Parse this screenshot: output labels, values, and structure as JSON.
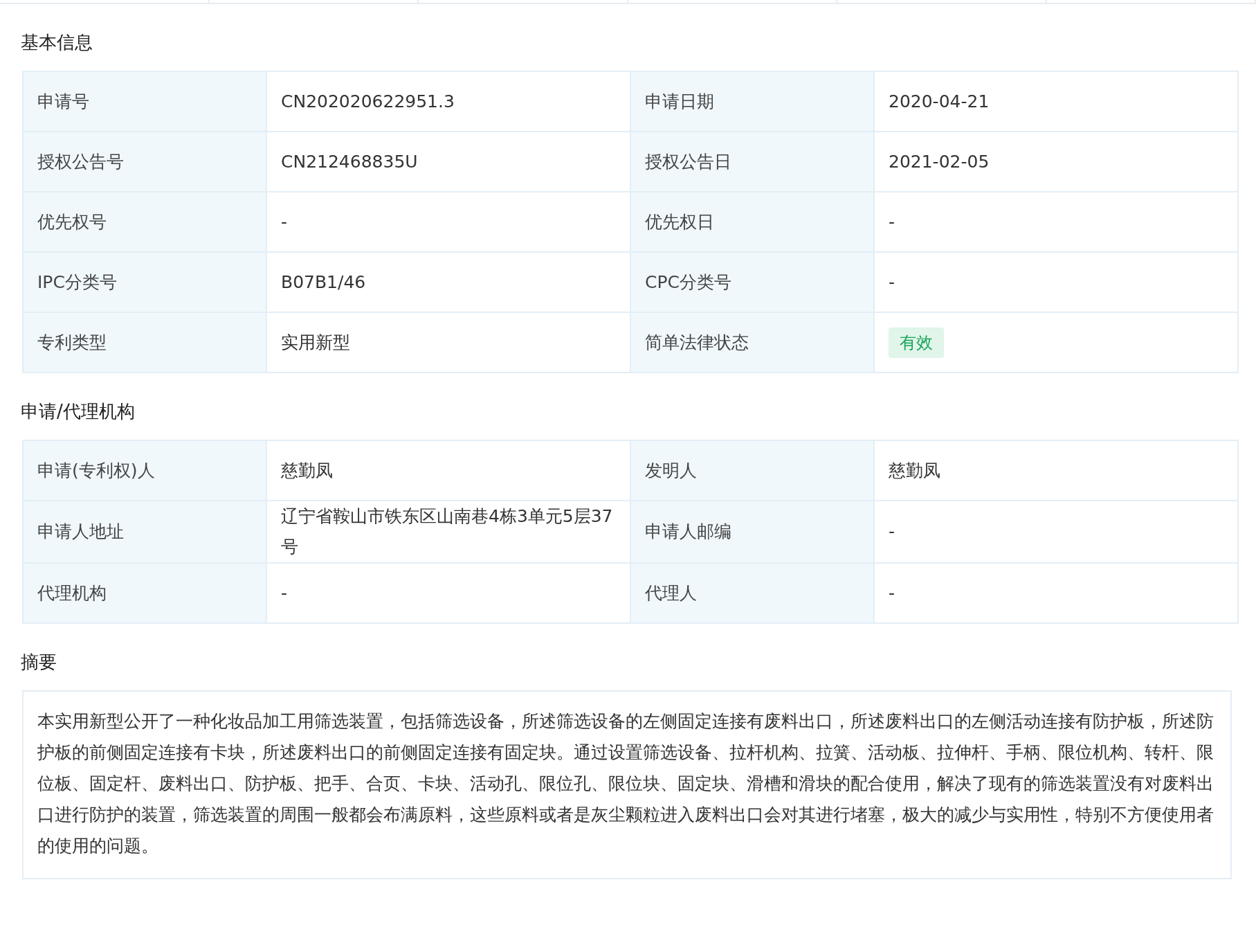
{
  "sections": [
    {
      "title": "基本信息",
      "kind": "table",
      "rows": [
        [
          {
            "label": "申请号",
            "value": "CN202020622951.3",
            "kind": "text"
          },
          {
            "label": "申请日期",
            "value": "2020-04-21",
            "kind": "text"
          }
        ],
        [
          {
            "label": "授权公告号",
            "value": "CN212468835U",
            "kind": "text"
          },
          {
            "label": "授权公告日",
            "value": "2021-02-05",
            "kind": "text"
          }
        ],
        [
          {
            "label": "优先权号",
            "value": "-",
            "kind": "text"
          },
          {
            "label": "优先权日",
            "value": "-",
            "kind": "text"
          }
        ],
        [
          {
            "label": "IPC分类号",
            "value": "B07B1/46",
            "kind": "text"
          },
          {
            "label": "CPC分类号",
            "value": "-",
            "kind": "text"
          }
        ],
        [
          {
            "label": "专利类型",
            "value": "实用新型",
            "kind": "text"
          },
          {
            "label": "简单法律状态",
            "value": "有效",
            "kind": "tag"
          }
        ]
      ]
    },
    {
      "title": "申请/代理机构",
      "kind": "table",
      "rows": [
        [
          {
            "label": "申请(专利权)人",
            "value": "慈勤凤",
            "kind": "text"
          },
          {
            "label": "发明人",
            "value": "慈勤凤",
            "kind": "text"
          }
        ],
        [
          {
            "label": "申请人地址",
            "value": "辽宁省鞍山市铁东区山南巷4栋3单元5层37号",
            "kind": "text"
          },
          {
            "label": "申请人邮编",
            "value": "-",
            "kind": "text"
          }
        ],
        [
          {
            "label": "代理机构",
            "value": "-",
            "kind": "text"
          },
          {
            "label": "代理人",
            "value": "-",
            "kind": "text"
          }
        ]
      ]
    },
    {
      "title": "摘要",
      "kind": "text",
      "text": "本实用新型公开了一种化妆品加工用筛选装置，包括筛选设备，所述筛选设备的左侧固定连接有废料出口，所述废料出口的左侧活动连接有防护板，所述防护板的前侧固定连接有卡块，所述废料出口的前侧固定连接有固定块。通过设置筛选设备、拉杆机构、拉簧、活动板、拉伸杆、手柄、限位机构、转杆、限位板、固定杆、废料出口、防护板、把手、合页、卡块、活动孔、限位孔、限位块、固定块、滑槽和滑块的配合使用，解决了现有的筛选装置没有对废料出口进行防护的装置，筛选装置的周围一般都会布满原料，这些原料或者是灰尘颗粒进入废料出口会对其进行堵塞，极大的减少与实用性，特别不方便使用者的使用的问题。"
    }
  ]
}
